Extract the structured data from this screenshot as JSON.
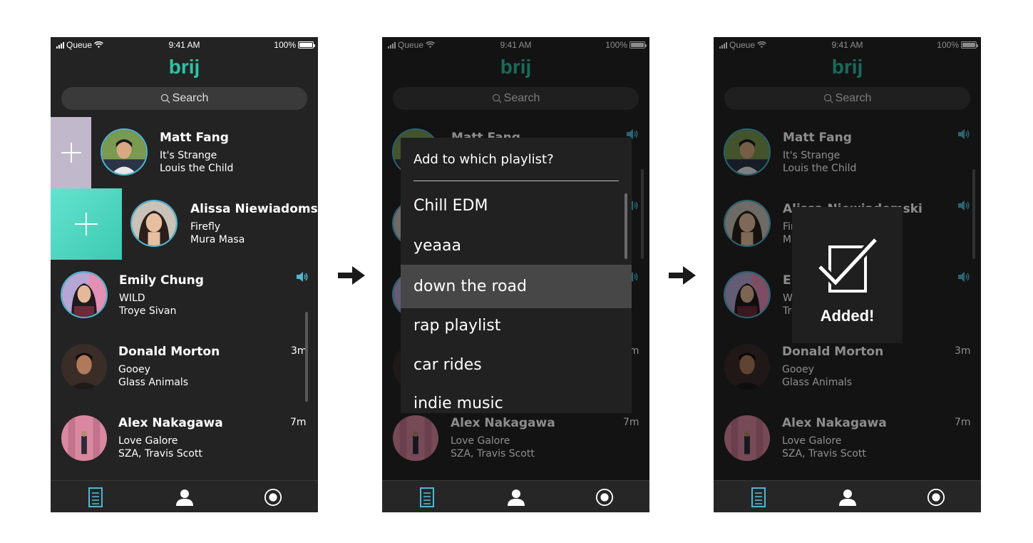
{
  "status": {
    "carrier": "Queue",
    "time": "9:41 AM",
    "battery": "100%"
  },
  "app": {
    "logo": "brij",
    "search_placeholder": "Search"
  },
  "feed": [
    {
      "name": "Matt Fang",
      "song": "It's Strange",
      "artist": "Louis the Child",
      "time": ""
    },
    {
      "name": "Alissa Niewiadomski",
      "song": "Firefly",
      "artist": "Mura Masa",
      "time": ""
    },
    {
      "name": "Emily Chung",
      "song": "WILD",
      "artist": "Troye Sivan",
      "time": ""
    },
    {
      "name": "Donald Morton",
      "song": "Gooey",
      "artist": "Glass Animals",
      "time": "3m"
    },
    {
      "name": "Alex Nakagawa",
      "song": "Love Galore",
      "artist": "SZA, Travis Scott",
      "time": "7m"
    }
  ],
  "modal": {
    "title": "Add to which playlist?",
    "playlists": [
      "Chill EDM",
      "yeaaa",
      "down the road",
      "rap playlist",
      "car rides",
      "indie music"
    ],
    "selected_index": 2
  },
  "toast": {
    "text": "Added!"
  },
  "colors": {
    "accent": "#2ec4a4",
    "ring": "#4fb7d2",
    "add_tile_lavender": "#c1b8cc",
    "add_tile_teal": "#4ed6c0",
    "bg": "#232323"
  },
  "icons": {
    "queue_tab": "list-doc-icon",
    "profile_tab": "person-icon",
    "record_tab": "record-icon",
    "speaker": "speaker-icon",
    "search": "search-icon"
  }
}
